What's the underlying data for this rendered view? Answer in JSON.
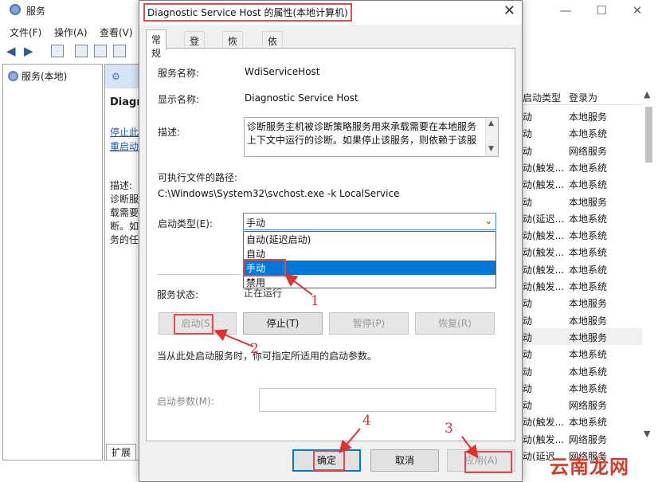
{
  "main_window": {
    "title": "服务",
    "menu": [
      "文件(F)",
      "操作(A)",
      "查看(V)"
    ],
    "tree_item": "服务(本地)",
    "middle": {
      "title": "Diagn",
      "link_stop": "停止此",
      "link_restart": "重启动",
      "desc_label": "描述:",
      "desc_lines": [
        "诊断服",
        "载需要",
        "断。如",
        "务的任"
      ]
    },
    "ext_tab": "扩展",
    "list_headers": {
      "startup_type": "启动类型",
      "logon_as": "登录为"
    },
    "list_rows": [
      {
        "startup": "动",
        "logon": "本地服务"
      },
      {
        "startup": "动",
        "logon": "本地系统"
      },
      {
        "startup": "动",
        "logon": "网络服务"
      },
      {
        "startup": "动(触发...",
        "logon": "本地系统"
      },
      {
        "startup": "动(触发...",
        "logon": "本地系统"
      },
      {
        "startup": "动",
        "logon": "本地服务"
      },
      {
        "startup": "动(延迟...",
        "logon": "本地系统"
      },
      {
        "startup": "动(触发...",
        "logon": "本地系统"
      },
      {
        "startup": "动(触发...",
        "logon": "本地系统"
      },
      {
        "startup": "动(触发...",
        "logon": "本地系统"
      },
      {
        "startup": "动(触发...",
        "logon": "本地系统"
      },
      {
        "startup": "动",
        "logon": "本地服务"
      },
      {
        "startup": "动",
        "logon": "本地服务"
      },
      {
        "startup": "动",
        "logon": "本地服务"
      },
      {
        "startup": "动",
        "logon": "本地系统"
      },
      {
        "startup": "动",
        "logon": "本地系统"
      },
      {
        "startup": "动",
        "logon": "本地系统"
      },
      {
        "startup": "动",
        "logon": "网络服务"
      },
      {
        "startup": "动(触发...",
        "logon": "本地系统"
      },
      {
        "startup": "动(触发...",
        "logon": "网络服务"
      },
      {
        "startup": "动(延迟...",
        "logon": "网络服务"
      }
    ],
    "selected_row_index": 13
  },
  "dialog": {
    "title": "Diagnostic Service Host 的属性(本地计算机)",
    "tabs": [
      "常规",
      "登录",
      "恢复",
      "依存关系"
    ],
    "service_name_label": "服务名称:",
    "service_name": "WdiServiceHost",
    "display_name_label": "显示名称:",
    "display_name": "Diagnostic Service Host",
    "description_label": "描述:",
    "description": "诊断服务主机被诊断策略服务用来承载需要在本地服务上下文中运行的诊断。如果停止该服务，则依赖于该服",
    "path_label": "可执行文件的路径:",
    "path": "C:\\Windows\\System32\\svchost.exe -k LocalService",
    "startup_type_label": "启动类型(E):",
    "startup_type_value": "手动",
    "startup_options": [
      "自动(延迟启动)",
      "自动",
      "手动",
      "禁用"
    ],
    "startup_selected_index": 2,
    "status_label": "服务状态:",
    "status_value": "正在运行",
    "buttons": {
      "start": "启动(S)",
      "stop": "停止(T)",
      "pause": "暂停(P)",
      "resume": "恢复(R)"
    },
    "hint": "当从此处启动服务时，你可指定所适用的启动参数。",
    "param_label": "启动参数(M):",
    "param_value": "",
    "footer": {
      "ok": "确定",
      "cancel": "取消",
      "apply": "应用(A)"
    }
  },
  "annotations": [
    "1",
    "2",
    "3",
    "4"
  ],
  "watermark": "云南龙网",
  "colors": {
    "annotation": "#e23030",
    "selection": "#0078d7"
  }
}
